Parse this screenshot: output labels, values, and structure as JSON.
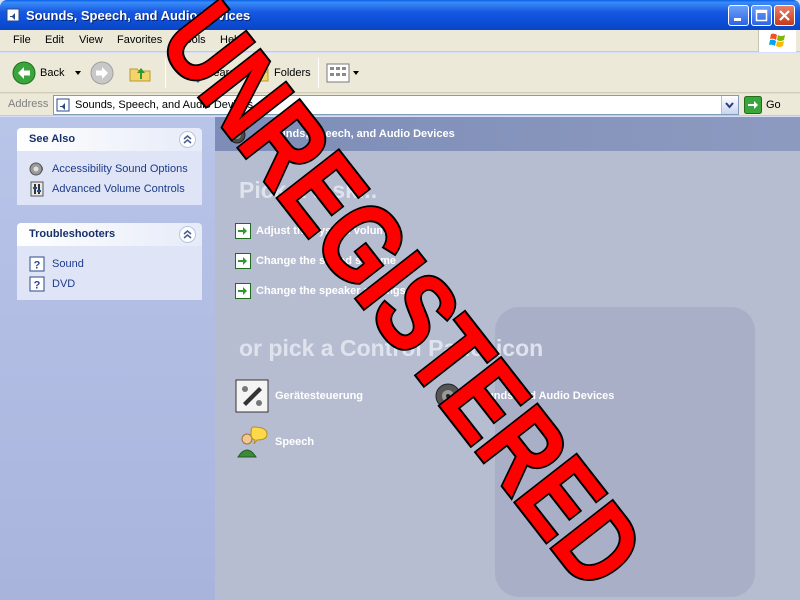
{
  "window": {
    "title": "Sounds, Speech, and Audio Devices"
  },
  "menu": {
    "items": [
      "File",
      "Edit",
      "View",
      "Favorites",
      "Tools",
      "Help"
    ]
  },
  "toolbar": {
    "back_label": "Back",
    "search_label": "Search",
    "folders_label": "Folders"
  },
  "address": {
    "label": "Address",
    "value": "Sounds, Speech, and Audio Devices",
    "go_label": "Go"
  },
  "see_also": {
    "title": "See Also",
    "links": [
      "Accessibility Sound Options",
      "Advanced Volume Controls"
    ]
  },
  "troubleshooters": {
    "title": "Troubleshooters",
    "links": [
      "Sound",
      "DVD"
    ]
  },
  "main": {
    "header": "Sounds, Speech, and Audio Devices",
    "pick_task": "Pick a task...",
    "tasks": [
      "Adjust the system volume",
      "Change the sound scheme",
      "Change the speaker settings"
    ],
    "or_pick": "or pick a Control Panel icon",
    "icons": [
      "Gerätesteuerung",
      "Sounds and Audio Devices",
      "Speech"
    ]
  },
  "watermark": {
    "text": "UNREGISTERED",
    "color": "#ff0000"
  }
}
